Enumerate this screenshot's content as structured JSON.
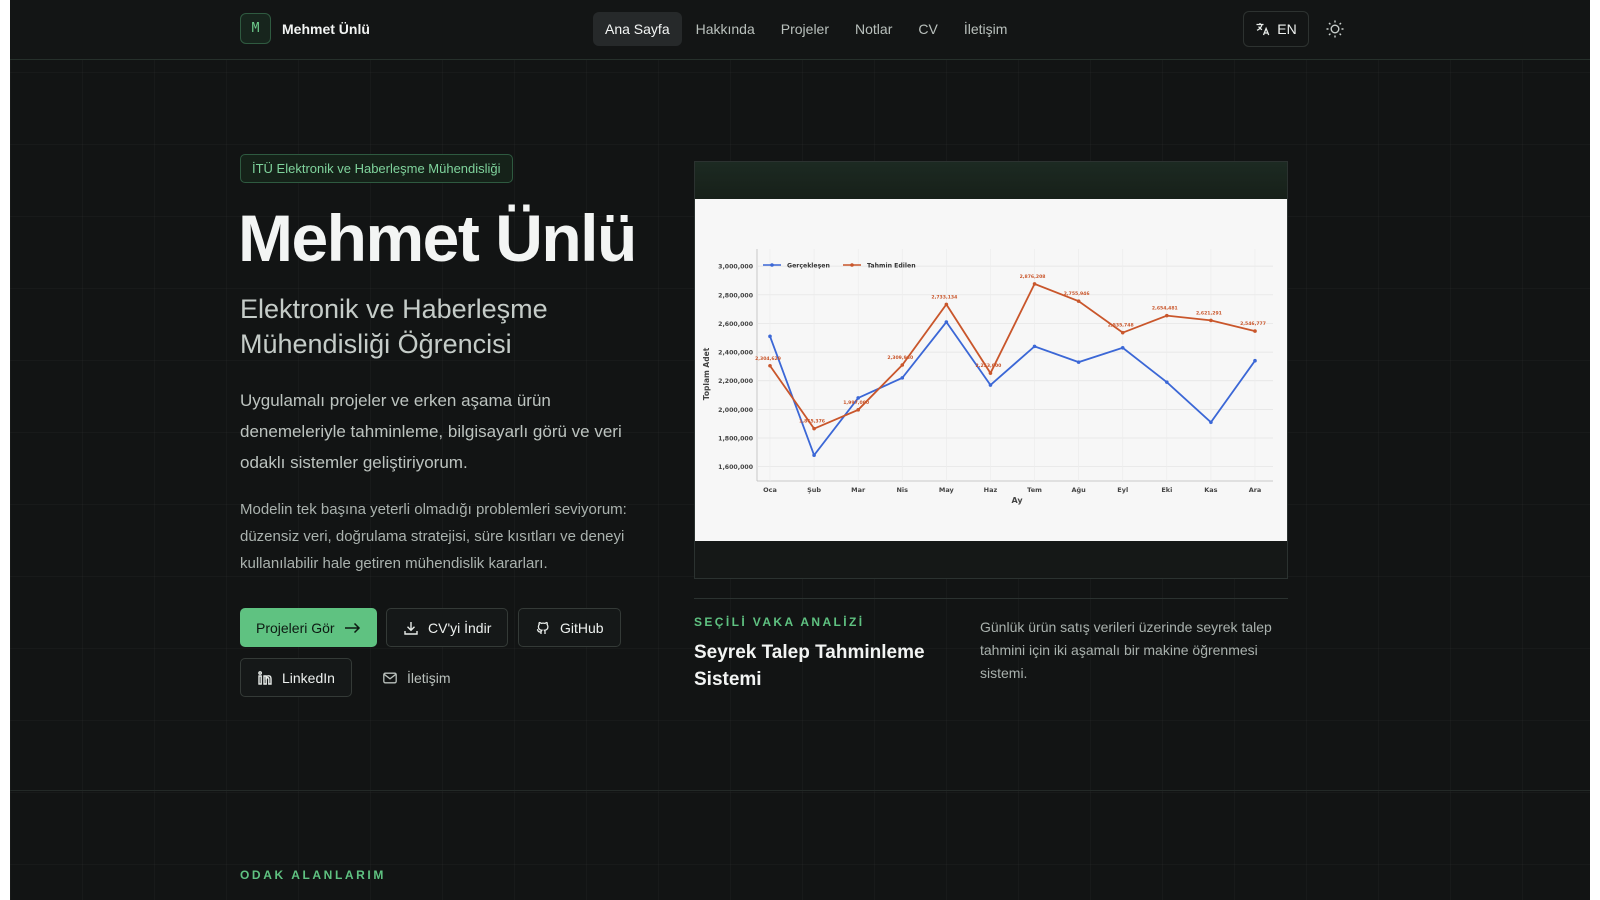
{
  "nav": {
    "brand_initial": "M",
    "brand_name": "Mehmet Ünlü",
    "links": [
      "Ana Sayfa",
      "Hakkında",
      "Projeler",
      "Notlar",
      "CV",
      "İletişim"
    ],
    "active_link": "Ana Sayfa",
    "language_label": "EN",
    "theme_icon": "sun-icon"
  },
  "hero": {
    "badge": "İTÜ Elektronik ve Haberleşme Mühendisliği",
    "title": "Mehmet Ünlü",
    "subtitle": "Elektronik ve Haberleşme Mühendisliği Öğrencisi",
    "lead": "Uygulamalı projeler ve erken aşama ürün denemeleriyle tahminleme, bilgisayarlı görü ve veri odaklı sistemler geliştiriyorum.",
    "description": "Modelin tek başına yeterli olmadığı problemleri seviyorum: düzensiz veri, doğrulama stratejisi, süre kısıtları ve deneyi kullanılabilir hale getiren mühendislik kararları.",
    "buttons": {
      "projects": "Projeleri Gör",
      "cv": "CV'yi İndir",
      "github": "GitHub",
      "linkedin": "LinkedIn",
      "contact": "İletişim"
    }
  },
  "case_study": {
    "label": "SEÇİLİ VAKA ANALİZİ",
    "title": "Seyrek Talep Tahminleme Sistemi",
    "description": "Günlük ürün satış verileri üzerinde seyrek talep tahmini için iki aşamalı bir makine öğrenmesi sistemi."
  },
  "next_section": {
    "label": "ODAK ALANLARIM"
  },
  "colors": {
    "accent": "#5fc281",
    "background": "#121414",
    "series_actual": "#3b67d6",
    "series_forecast": "#c9562b"
  },
  "chart_data": {
    "type": "line",
    "xlabel": "Ay",
    "ylabel": "Toplam Adet",
    "categories": [
      "Oca",
      "Şub",
      "Mar",
      "Nis",
      "May",
      "Haz",
      "Tem",
      "Ağu",
      "Eyl",
      "Eki",
      "Kas",
      "Ara"
    ],
    "ylim": [
      1500000,
      3050000
    ],
    "yticks": [
      "1,600,000",
      "1,800,000",
      "2,000,000",
      "2,200,000",
      "2,400,000",
      "2,600,000",
      "2,800,000",
      "3,000,000"
    ],
    "ytick_values": [
      1600000,
      1800000,
      2000000,
      2200000,
      2400000,
      2600000,
      2800000,
      3000000
    ],
    "legend_position": "top-left",
    "grid": true,
    "series": [
      {
        "name": "Gerçekleşen",
        "values": [
          2510000,
          1680000,
          2080000,
          2220000,
          2610000,
          2170000,
          2440000,
          2330000,
          2430000,
          2190000,
          1910000,
          2340000
        ]
      },
      {
        "name": "Tahmin Edilen",
        "values": [
          2304629,
          1865376,
          1997000,
          2309960,
          2733134,
          2253000,
          2876208,
          2755946,
          2535748,
          2654481,
          2621291,
          2546777
        ],
        "labels": [
          "2,304,629",
          "1,865,376",
          "1,997,000",
          "2,309,960",
          "2,733,134",
          "2,253,000",
          "2,876,208",
          "2,755,946",
          "2,535,748",
          "2,654,481",
          "2,621,291",
          "2,546,777"
        ]
      }
    ]
  }
}
